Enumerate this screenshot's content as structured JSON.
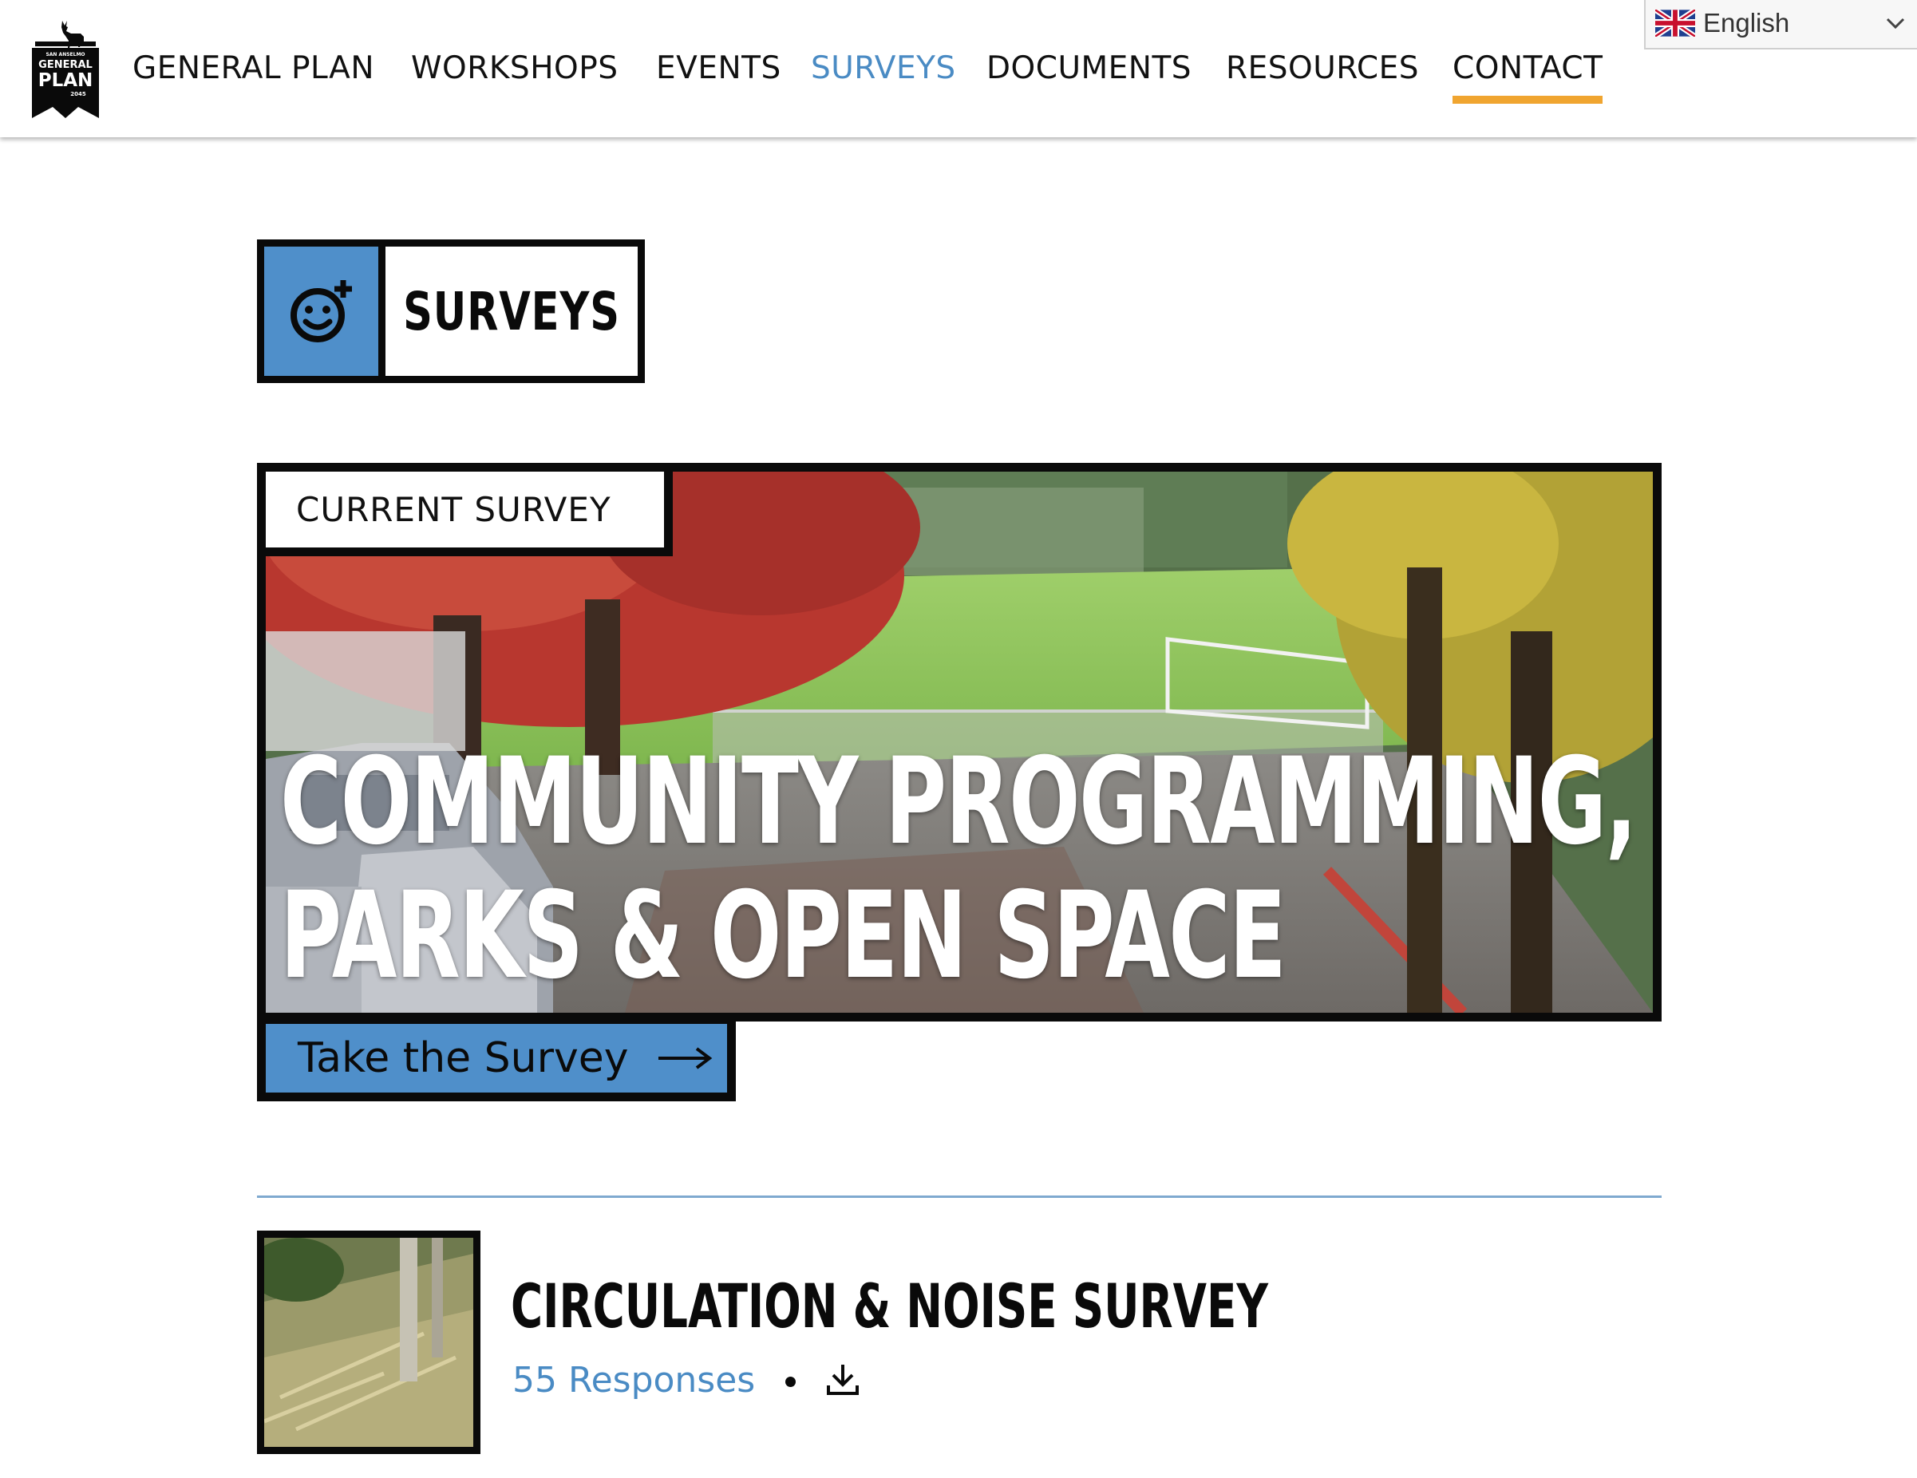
{
  "header": {
    "logo": {
      "icon": "deer-logo-icon",
      "line1": "SAN ANSELMO",
      "line2": "GENERAL",
      "line3": "PLAN",
      "line4": "2045"
    },
    "nav": [
      {
        "label": "GENERAL PLAN",
        "state": "default"
      },
      {
        "label": "WORKSHOPS",
        "state": "default"
      },
      {
        "label": "EVENTS",
        "state": "default"
      },
      {
        "label": "SURVEYS",
        "state": "active"
      },
      {
        "label": "DOCUMENTS",
        "state": "default"
      },
      {
        "label": "RESOURCES",
        "state": "default"
      },
      {
        "label": "CONTACT",
        "state": "hover-underlined"
      }
    ],
    "language": {
      "selected": "English",
      "flag": "uk-flag-icon",
      "caret": "chevron-down-icon"
    }
  },
  "page": {
    "title": "SURVEYS",
    "title_icon": "smiley-plus-icon"
  },
  "featured": {
    "label": "CURRENT SURVEY",
    "title": "COMMUNITY PROGRAMMING, PARKS & OPEN SPACE",
    "cta_label": "Take the Survey",
    "cta_icon": "arrow-right-icon"
  },
  "past_surveys": [
    {
      "title": "CIRCULATION & NOISE SURVEY",
      "responses": "55 Responses",
      "separator": "•",
      "download_icon": "download-icon"
    }
  ],
  "colors": {
    "accent_blue": "#4f8fca",
    "link_blue": "#4a8bc4",
    "underline_orange": "#f0a530",
    "border_black": "#0a0a0a"
  }
}
